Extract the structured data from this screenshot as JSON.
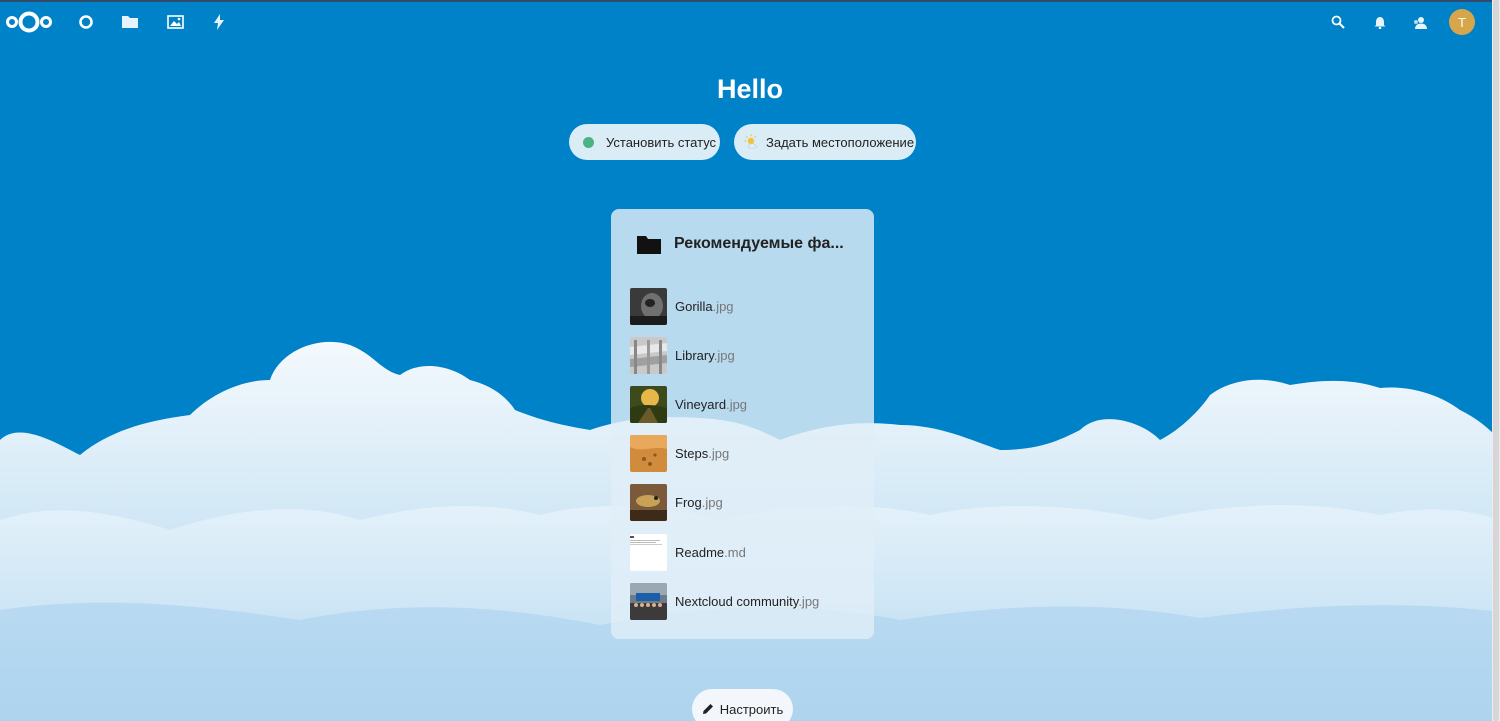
{
  "header": {
    "apps": [
      {
        "name": "dashboard",
        "icon": "dashboard-icon"
      },
      {
        "name": "files",
        "icon": "folder-icon"
      },
      {
        "name": "photos",
        "icon": "image-icon"
      },
      {
        "name": "activity",
        "icon": "lightning-icon"
      }
    ],
    "right_icons": [
      "search-icon",
      "bell-icon",
      "contacts-icon"
    ],
    "avatar_initial": "T"
  },
  "greeting": "Hello",
  "status_buttons": {
    "set_status": "Установить статус",
    "set_location": "Задать местоположение"
  },
  "recommended": {
    "title": "Рекомендуемые фа...",
    "files": [
      {
        "base": "Gorilla",
        "ext": ".jpg"
      },
      {
        "base": "Library",
        "ext": ".jpg"
      },
      {
        "base": "Vineyard",
        "ext": ".jpg"
      },
      {
        "base": "Steps",
        "ext": ".jpg"
      },
      {
        "base": "Frog",
        "ext": ".jpg"
      },
      {
        "base": "Readme",
        "ext": ".md"
      },
      {
        "base": "Nextcloud community",
        "ext": ".jpg"
      }
    ]
  },
  "customize_label": "Настроить",
  "colors": {
    "primary": "#0082c9",
    "status_online": "#49b382",
    "avatar": "#d8a64a"
  }
}
